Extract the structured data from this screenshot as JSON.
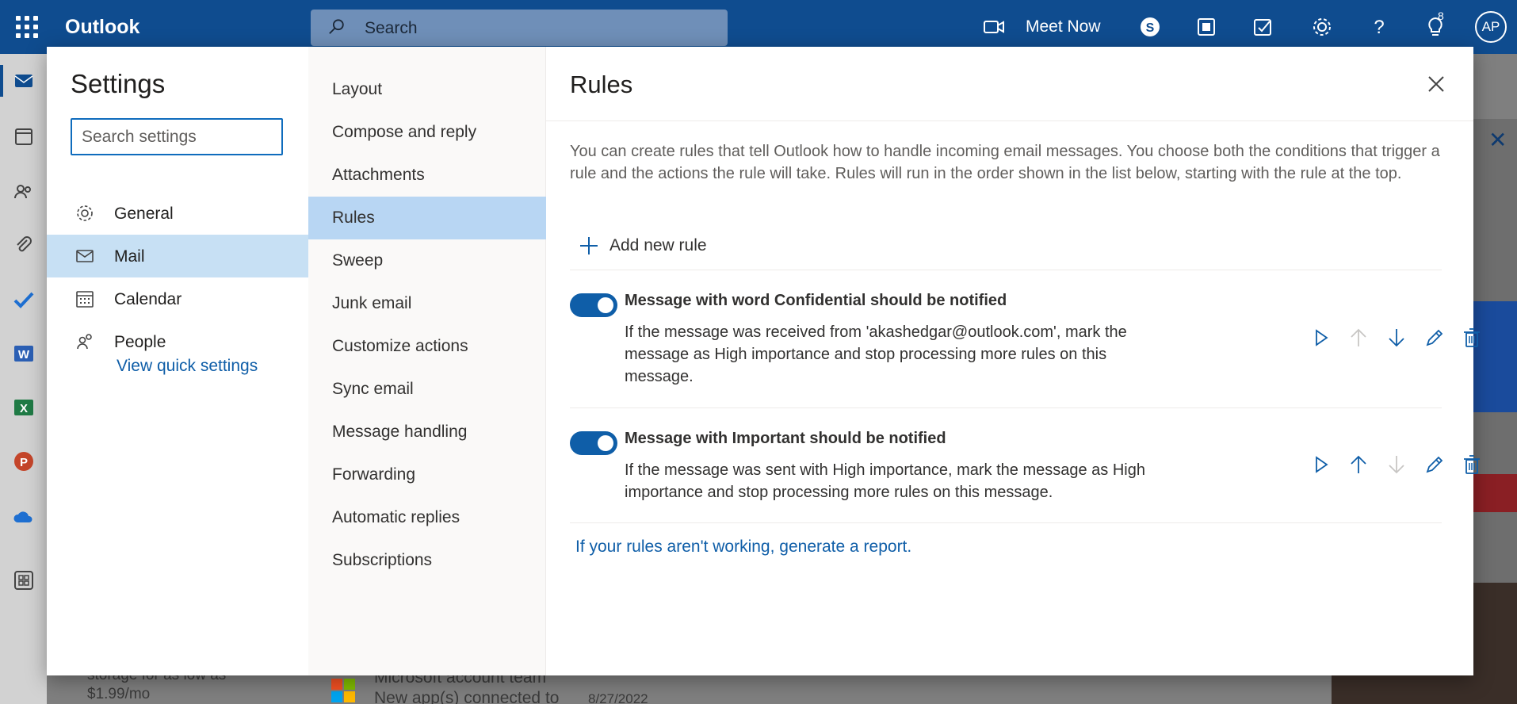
{
  "topbar": {
    "app_name": "Outlook",
    "search_placeholder": "Search",
    "meet_now_label": "Meet Now",
    "notification_count": "8",
    "avatar_initials": "AP"
  },
  "background": {
    "storage_text_1": "storage for as low as",
    "storage_text_2": "$1.99/mo",
    "sender": "Microsoft account team",
    "preview": "New app(s) connected to",
    "date": "8/27/2022"
  },
  "settings": {
    "title": "Settings",
    "search_placeholder": "Search settings",
    "categories": [
      {
        "label": "General",
        "icon": "gear-icon",
        "active": false
      },
      {
        "label": "Mail",
        "icon": "mail-icon",
        "active": true
      },
      {
        "label": "Calendar",
        "icon": "calendar-icon",
        "active": false
      },
      {
        "label": "People",
        "icon": "people-icon",
        "active": false
      }
    ],
    "quick_settings_link": "View quick settings",
    "mail_sections": [
      {
        "label": "Layout"
      },
      {
        "label": "Compose and reply"
      },
      {
        "label": "Attachments"
      },
      {
        "label": "Rules",
        "active": true
      },
      {
        "label": "Sweep"
      },
      {
        "label": "Junk email"
      },
      {
        "label": "Customize actions"
      },
      {
        "label": "Sync email"
      },
      {
        "label": "Message handling"
      },
      {
        "label": "Forwarding"
      },
      {
        "label": "Automatic replies"
      },
      {
        "label": "Subscriptions"
      }
    ]
  },
  "rules": {
    "title": "Rules",
    "intro": "You can create rules that tell Outlook how to handle incoming email messages. You choose both the conditions that trigger a rule and the actions the rule will take. Rules will run in the order shown in the list below, starting with the rule at the top.",
    "add_rule_label": "Add new rule",
    "items": [
      {
        "name": "Message with word Confidential should be notified",
        "description": "If the message was received from 'akashedgar@outlook.com', mark the message as High importance and stop processing more rules on this message.",
        "enabled": true,
        "can_move_up": false,
        "can_move_down": true
      },
      {
        "name": "Message with Important should be notified",
        "description": "If the message was sent with High importance, mark the message as High importance and stop processing more rules on this message.",
        "enabled": true,
        "can_move_up": true,
        "can_move_down": false
      }
    ],
    "report_link": "If your rules aren't working, generate a report."
  },
  "colors": {
    "brand_blue": "#0f4c8f",
    "accent": "#0f5ea8",
    "selected_bg": "#c7e0f4"
  }
}
